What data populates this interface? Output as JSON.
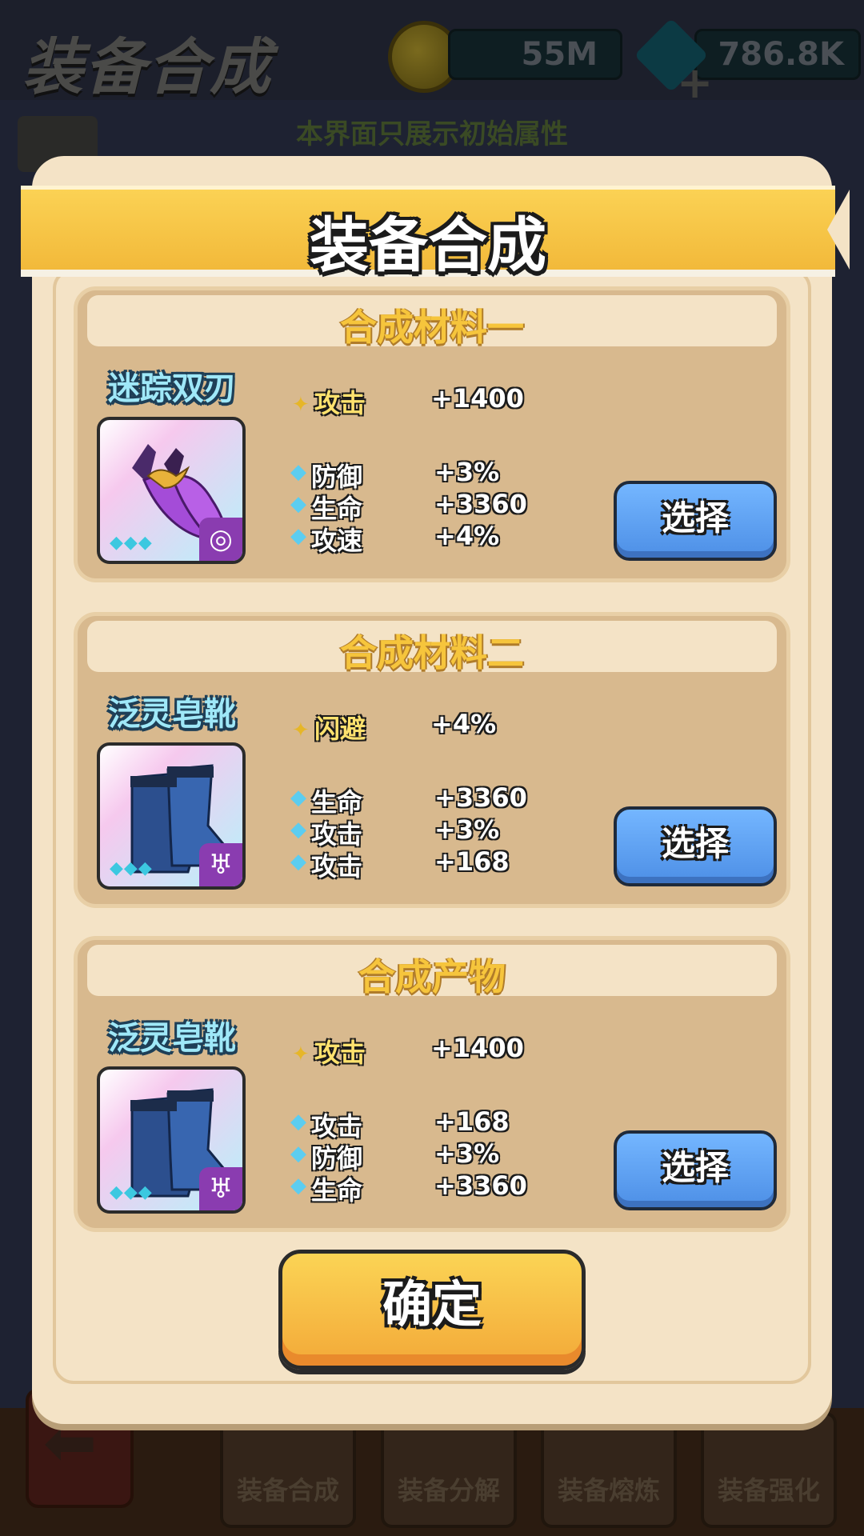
{
  "background": {
    "title": "装备合成",
    "coins": "55M",
    "gems": "786.8K",
    "notice": "本界面只展示初始属性",
    "tabs": [
      "装备合成",
      "装备分解",
      "装备熔炼",
      "装备强化"
    ]
  },
  "dialog": {
    "title": "装备合成",
    "confirm_label": "确定",
    "sections": [
      {
        "header": "合成材料一",
        "item_name": "迷踪双刃",
        "main_stat": {
          "name": "攻击",
          "value": "+1400"
        },
        "sub_stats": [
          {
            "name": "防御",
            "value": "+3%"
          },
          {
            "name": "生命",
            "value": "+3360"
          },
          {
            "name": "攻速",
            "value": "+4%"
          }
        ],
        "select_label": "选择"
      },
      {
        "header": "合成材料二",
        "item_name": "泛灵皂靴",
        "main_stat": {
          "name": "闪避",
          "value": "+4%"
        },
        "sub_stats": [
          {
            "name": "生命",
            "value": "+3360"
          },
          {
            "name": "攻击",
            "value": "+3%"
          },
          {
            "name": "攻击",
            "value": "+168"
          }
        ],
        "select_label": "选择"
      },
      {
        "header": "合成产物",
        "item_name": "泛灵皂靴",
        "main_stat": {
          "name": "攻击",
          "value": "+1400"
        },
        "sub_stats": [
          {
            "name": "攻击",
            "value": "+168"
          },
          {
            "name": "防御",
            "value": "+3%"
          },
          {
            "name": "生命",
            "value": "+3360"
          }
        ],
        "select_label": "选择"
      }
    ]
  },
  "icons": {
    "main_stat": "star-icon",
    "sub_stat": "gem-icon",
    "item_rarity": "gem-icon",
    "badge_1": "spiral-icon",
    "badge_2": "wing-icon"
  },
  "colors": {
    "banner": "#f6c53c",
    "panel": "#f4e3c6",
    "section": "#d8b98e",
    "select_button": "#5c9ff0",
    "confirm_button": "#f6b93c"
  }
}
